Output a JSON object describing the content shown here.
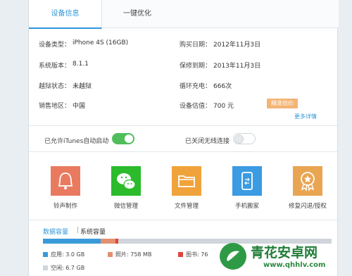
{
  "tabs": [
    {
      "label": "设备信息",
      "active": true
    },
    {
      "label": "一键优化",
      "active": false
    }
  ],
  "info": {
    "device_type_label": "设备类型：",
    "device_type_value": "iPhone 4S   (16GB)",
    "purchase_date_label": "购买日期：",
    "purchase_date_value": "2012年11月3日",
    "sys_version_label": "系统版本：",
    "sys_version_value": "8.1.1",
    "warranty_label": "保修到期：",
    "warranty_value": "2013年11月3日",
    "jailbreak_label": "越狱状态：",
    "jailbreak_value": "未越狱",
    "charge_cycle_label": "循环充电：",
    "charge_cycle_value": "666次",
    "region_label": "销售地区：",
    "region_value": "中国",
    "valuation_label": "设备估值：",
    "valuation_value": "700 元",
    "precise_button": "精准估价",
    "more_link": "更多详情"
  },
  "toggles": {
    "itunes_label": "已允许iTunes自动启动",
    "itunes_on": true,
    "wireless_label": "已关闭无线连接",
    "wireless_on": false
  },
  "tools": [
    {
      "label": "铃声制作",
      "icon": "bell-icon",
      "color": "#e97a60"
    },
    {
      "label": "微信管理",
      "icon": "wechat-icon",
      "color": "#2bbb2b"
    },
    {
      "label": "文件管理",
      "icon": "folder-icon",
      "color": "#f0a33a"
    },
    {
      "label": "手机搬家",
      "icon": "phone-transfer-icon",
      "color": "#3b9be3"
    },
    {
      "label": "修复闪退/授权",
      "icon": "repair-badge-icon",
      "color": "#e9a552"
    }
  ],
  "storage": {
    "tab_data": "数据容量",
    "tab_system": "系统容量",
    "apps": "应用: 3.0 GB",
    "photos": "照片: 758 MB",
    "books": "图书: 76",
    "free": "空闲: 6.7 GB",
    "colors": {
      "apps": "#3a9ad9",
      "photos": "#e3906e",
      "books": "#e0453c",
      "free": "#cfd5da"
    },
    "fractions": {
      "apps": 0.2,
      "photos": 0.05,
      "books": 0.01
    }
  },
  "watermark": {
    "title": "青花安卓网",
    "url": "www.qhhlv.com"
  }
}
